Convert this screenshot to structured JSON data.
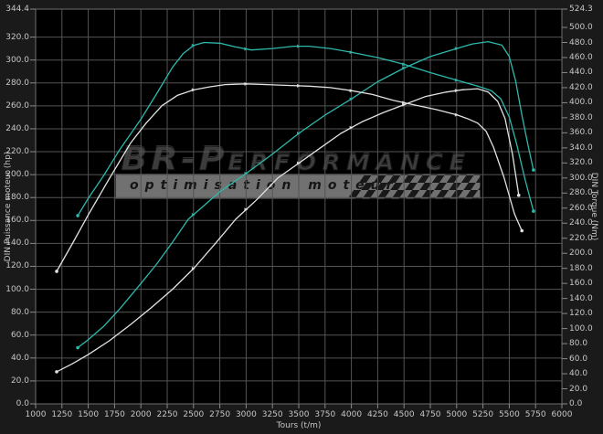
{
  "axes": {
    "x": {
      "title": "Tours (t/m)",
      "min": 1000,
      "max": 6000,
      "tick_labels": [
        "1000",
        "1250",
        "1500",
        "1750",
        "2000",
        "2250",
        "2500",
        "2750",
        "3000",
        "3250",
        "3500",
        "3750",
        "4000",
        "4250",
        "4500",
        "4750",
        "5000",
        "5250",
        "5500",
        "5750",
        "6000"
      ]
    },
    "left": {
      "title": "DIN Puissance moteur (hp)",
      "min": 0,
      "max": 344.4,
      "tick_labels": [
        "344.4",
        "320.0",
        "300.0",
        "280.0",
        "260.0",
        "240.0",
        "220.0",
        "200.0",
        "180.0",
        "160.0",
        "140.0",
        "120.0",
        "100.0",
        "80.0",
        "60.0",
        "40.0",
        "20.0",
        "0.0"
      ]
    },
    "right": {
      "title": "DIN Torque (Nm)",
      "min": 0,
      "max": 524.3,
      "tick_labels": [
        "524.3",
        "500.0",
        "480.0",
        "460.0",
        "440.0",
        "420.0",
        "400.0",
        "380.0",
        "360.0",
        "340.0",
        "320.0",
        "300.0",
        "280.0",
        "260.0",
        "240.0",
        "220.0",
        "200.0",
        "180.0",
        "160.0",
        "140.0",
        "120.0",
        "100.0",
        "80.0",
        "60.0",
        "40.0",
        "20.0",
        "0.0"
      ]
    }
  },
  "colors": {
    "tuned_curve": "#2eb8ac",
    "stock_curve": "#e3e3e3",
    "grid": "#545454",
    "border": "#6e6e6e",
    "tick": "#8a8a8a",
    "plot_bg": "#000000",
    "outer_bg": "#1a1a1a"
  },
  "watermark": {
    "brand_prefix": "BR-P",
    "brand_suffix": "ERFORMANCE",
    "tagline": "optimisation  moteur"
  },
  "chart_data": {
    "type": "line",
    "title": "",
    "xlabel": "Tours (t/m)",
    "ylabel_left": "DIN Puissance moteur (hp)",
    "ylabel_right": "DIN Torque (Nm)",
    "x_range": [
      1000,
      6000
    ],
    "left_range": [
      0,
      344.4
    ],
    "right_range": [
      0,
      524.3
    ],
    "grid": true,
    "legend": false,
    "series": [
      {
        "name": "power_tuned",
        "axis": "left",
        "unit": "hp",
        "color": "#2eb8ac",
        "points": [
          [
            1400,
            49
          ],
          [
            1500,
            56
          ],
          [
            1650,
            68
          ],
          [
            1800,
            83
          ],
          [
            2000,
            105
          ],
          [
            2150,
            122
          ],
          [
            2300,
            141
          ],
          [
            2450,
            161
          ],
          [
            2600,
            173
          ],
          [
            2750,
            185
          ],
          [
            3000,
            201
          ],
          [
            3250,
            218
          ],
          [
            3500,
            236
          ],
          [
            3750,
            252
          ],
          [
            4000,
            266
          ],
          [
            4250,
            281
          ],
          [
            4500,
            293
          ],
          [
            4750,
            303
          ],
          [
            5000,
            310
          ],
          [
            5150,
            314
          ],
          [
            5300,
            316
          ],
          [
            5430,
            313
          ],
          [
            5500,
            303
          ],
          [
            5560,
            282
          ],
          [
            5620,
            252
          ],
          [
            5680,
            225
          ],
          [
            5730,
            204
          ]
        ]
      },
      {
        "name": "torque_tuned",
        "axis": "right",
        "unit": "Nm",
        "color": "#2eb8ac",
        "points": [
          [
            1400,
            250
          ],
          [
            1500,
            273
          ],
          [
            1650,
            304
          ],
          [
            1800,
            338
          ],
          [
            2000,
            378
          ],
          [
            2150,
            412
          ],
          [
            2300,
            447
          ],
          [
            2400,
            465
          ],
          [
            2500,
            476
          ],
          [
            2600,
            480
          ],
          [
            2750,
            479
          ],
          [
            2900,
            474
          ],
          [
            3050,
            470
          ],
          [
            3250,
            472
          ],
          [
            3450,
            475
          ],
          [
            3600,
            475
          ],
          [
            3800,
            472
          ],
          [
            4000,
            467
          ],
          [
            4250,
            460
          ],
          [
            4500,
            451
          ],
          [
            4750,
            440
          ],
          [
            5000,
            430
          ],
          [
            5200,
            422
          ],
          [
            5330,
            416
          ],
          [
            5420,
            405
          ],
          [
            5500,
            381
          ],
          [
            5570,
            345
          ],
          [
            5650,
            298
          ],
          [
            5730,
            256
          ]
        ]
      },
      {
        "name": "power_stock",
        "axis": "left",
        "unit": "hp",
        "color": "#e3e3e3",
        "points": [
          [
            1200,
            28
          ],
          [
            1350,
            35
          ],
          [
            1500,
            43
          ],
          [
            1700,
            55
          ],
          [
            1900,
            69
          ],
          [
            2100,
            84
          ],
          [
            2300,
            100
          ],
          [
            2500,
            118
          ],
          [
            2700,
            139
          ],
          [
            2900,
            161
          ],
          [
            3100,
            178
          ],
          [
            3300,
            197
          ],
          [
            3500,
            210
          ],
          [
            3700,
            223
          ],
          [
            3900,
            236
          ],
          [
            4100,
            246
          ],
          [
            4300,
            254
          ],
          [
            4500,
            261
          ],
          [
            4700,
            268
          ],
          [
            4900,
            272
          ],
          [
            5050,
            274
          ],
          [
            5200,
            275
          ],
          [
            5300,
            272
          ],
          [
            5390,
            264
          ],
          [
            5460,
            249
          ],
          [
            5530,
            218
          ],
          [
            5590,
            182
          ]
        ]
      },
      {
        "name": "torque_stock",
        "axis": "right",
        "unit": "Nm",
        "color": "#e3e3e3",
        "points": [
          [
            1200,
            176
          ],
          [
            1350,
            213
          ],
          [
            1500,
            251
          ],
          [
            1700,
            299
          ],
          [
            1900,
            346
          ],
          [
            2050,
            373
          ],
          [
            2200,
            396
          ],
          [
            2350,
            410
          ],
          [
            2500,
            417
          ],
          [
            2650,
            421
          ],
          [
            2800,
            424
          ],
          [
            3000,
            425
          ],
          [
            3200,
            424
          ],
          [
            3400,
            423
          ],
          [
            3600,
            422
          ],
          [
            3800,
            420
          ],
          [
            4000,
            416
          ],
          [
            4200,
            411
          ],
          [
            4400,
            403
          ],
          [
            4600,
            397
          ],
          [
            4800,
            391
          ],
          [
            5000,
            384
          ],
          [
            5100,
            379
          ],
          [
            5200,
            373
          ],
          [
            5280,
            362
          ],
          [
            5350,
            341
          ],
          [
            5450,
            301
          ],
          [
            5550,
            252
          ],
          [
            5620,
            230
          ]
        ]
      }
    ]
  }
}
